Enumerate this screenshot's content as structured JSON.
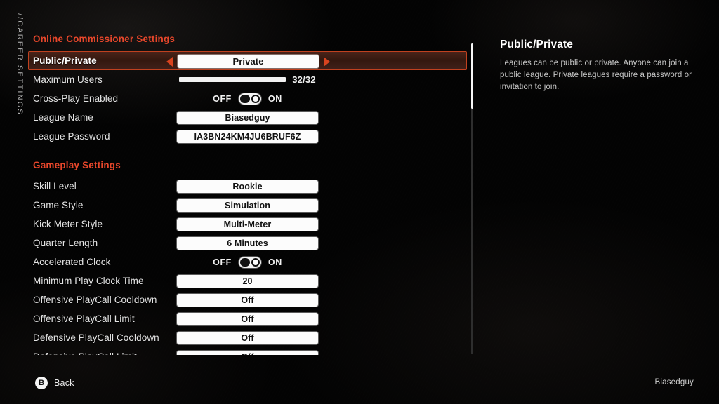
{
  "screen": {
    "vertical_tab": "//CAREER SETTINGS",
    "accent_color": "#e8472b",
    "selected_row_border": "#c0411f",
    "selected_row_bg": "#33180f"
  },
  "sections": [
    {
      "header": "Online Commissioner Settings",
      "rows": [
        {
          "label": "Public/Private",
          "type": "spinner",
          "value": "Private",
          "selected": true
        },
        {
          "label": "Maximum Users",
          "type": "slider",
          "value": "32/32",
          "fill_percent": 100
        },
        {
          "label": "Cross-Play Enabled",
          "type": "toggle",
          "value": "ON",
          "off_label": "OFF",
          "on_label": "ON"
        },
        {
          "label": "League Name",
          "type": "pill",
          "value": "Biasedguy"
        },
        {
          "label": "League Password",
          "type": "pill",
          "value": "IA3BN24KM4JU6BRUF6Z"
        }
      ]
    },
    {
      "header": "Gameplay Settings",
      "rows": [
        {
          "label": "Skill Level",
          "type": "pill",
          "value": "Rookie"
        },
        {
          "label": "Game Style",
          "type": "pill",
          "value": "Simulation"
        },
        {
          "label": "Kick Meter Style",
          "type": "pill",
          "value": "Multi-Meter"
        },
        {
          "label": "Quarter Length",
          "type": "pill",
          "value": "6 Minutes"
        },
        {
          "label": "Accelerated Clock",
          "type": "toggle",
          "value": "ON",
          "off_label": "OFF",
          "on_label": "ON"
        },
        {
          "label": "Minimum Play Clock Time",
          "type": "pill",
          "value": "20"
        },
        {
          "label": "Offensive PlayCall Cooldown",
          "type": "pill",
          "value": "Off"
        },
        {
          "label": "Offensive PlayCall Limit",
          "type": "pill",
          "value": "Off"
        },
        {
          "label": "Defensive PlayCall Cooldown",
          "type": "pill",
          "value": "Off"
        },
        {
          "label": "Defensive PlayCall Limit",
          "type": "pill",
          "value": "Off"
        }
      ]
    }
  ],
  "info": {
    "title": "Public/Private",
    "body": "Leagues can be public or private.  Anyone can join a public league.  Private leagues require a password or invitation to join."
  },
  "footer": {
    "back_glyph": "B",
    "back_label": "Back",
    "user": "Biasedguy"
  }
}
